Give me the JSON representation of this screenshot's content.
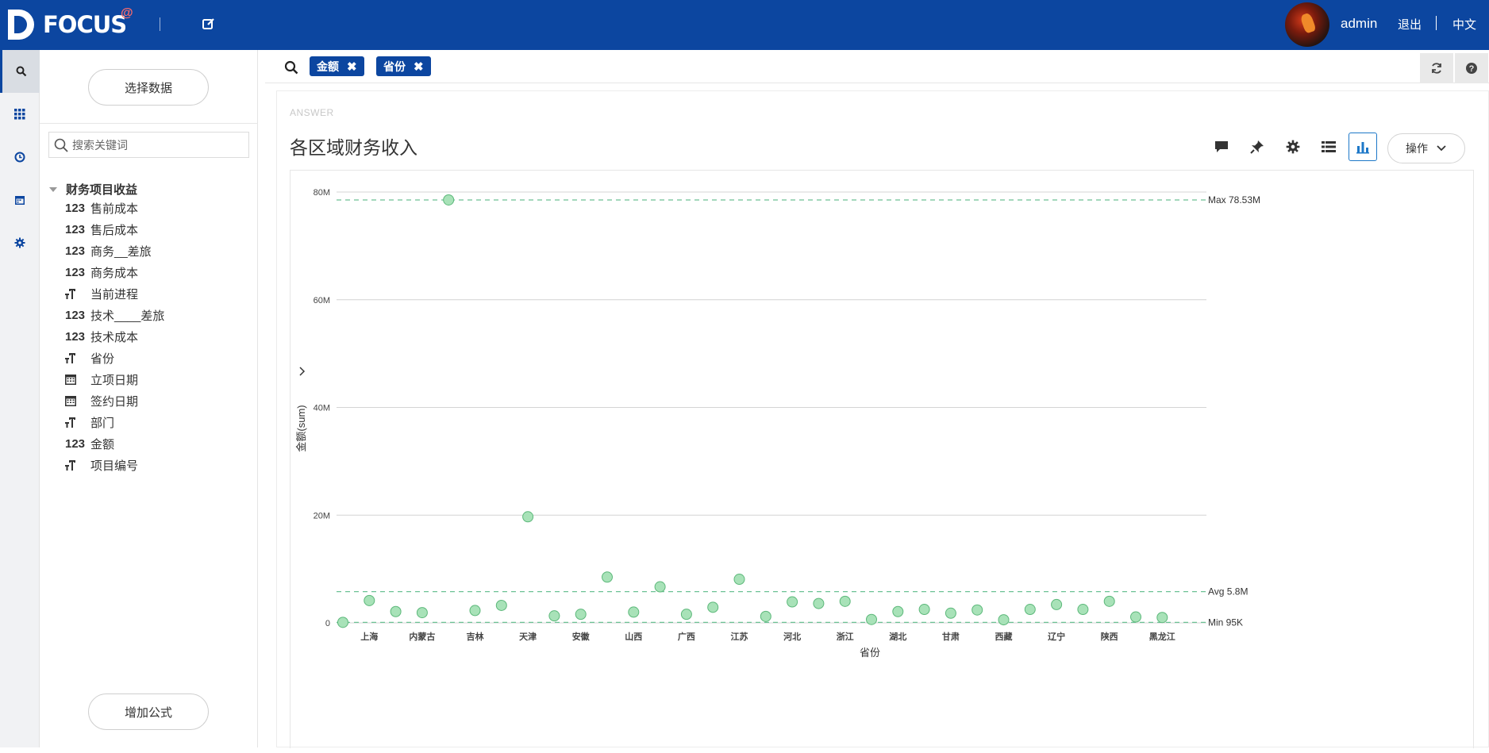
{
  "app": {
    "logo_text": "FOCUS",
    "logo_superscript": "@",
    "user": "admin",
    "logout": "退出",
    "language": "中文",
    "colors": {
      "topbar": "#0c46a0",
      "chip": "#0c46a0",
      "point_fill": "#a8e2b8",
      "point_stroke": "#5cb87a",
      "ref_line": "#6cc194"
    }
  },
  "rail": {
    "items": [
      "search-icon",
      "grid-icon",
      "clock-icon",
      "calendar-icon",
      "gear-icon"
    ]
  },
  "sidebar": {
    "select_data_button": "选择数据",
    "search_placeholder": "搜索关键词",
    "root_label": "财务项目收益",
    "fields": [
      {
        "type": "123",
        "label": "售前成本"
      },
      {
        "type": "123",
        "label": "售后成本"
      },
      {
        "type": "123",
        "label": "商务__差旅"
      },
      {
        "type": "123",
        "label": "商务成本"
      },
      {
        "type": "text",
        "label": "当前进程"
      },
      {
        "type": "123",
        "label": "技术____差旅"
      },
      {
        "type": "123",
        "label": "技术成本"
      },
      {
        "type": "text",
        "label": "省份"
      },
      {
        "type": "date",
        "label": "立项日期"
      },
      {
        "type": "date",
        "label": "签约日期"
      },
      {
        "type": "text",
        "label": "部门"
      },
      {
        "type": "123",
        "label": "金额"
      },
      {
        "type": "text",
        "label": "项目编号"
      }
    ],
    "add_formula_button": "增加公式"
  },
  "query": {
    "chips": [
      {
        "label": "金额"
      },
      {
        "label": "省份"
      }
    ]
  },
  "answer": {
    "tag": "ANSWER",
    "title": "各区域财务收入",
    "ops_label": "操作"
  },
  "chart_data": {
    "type": "scatter",
    "title": "各区域财务收入",
    "ylabel": "金额(sum)",
    "xlabel": "省份",
    "ylim": [
      0,
      80000000
    ],
    "yticks": [
      {
        "value": 0,
        "label": "0"
      },
      {
        "value": 20000000,
        "label": "20M"
      },
      {
        "value": 40000000,
        "label": "40M"
      },
      {
        "value": 60000000,
        "label": "60M"
      },
      {
        "value": 80000000,
        "label": "80M"
      }
    ],
    "x_tick_labels": [
      "上海",
      "内蒙古",
      "吉林",
      "天津",
      "安徽",
      "山西",
      "广西",
      "江苏",
      "河北",
      "浙江",
      "湖北",
      "甘肃",
      "西藏",
      "辽宁",
      "陕西",
      "黑龙江"
    ],
    "x_tick_positions": [
      1,
      3,
      5,
      7,
      9,
      11,
      13,
      15,
      17,
      19,
      21,
      23,
      25,
      27,
      29,
      31
    ],
    "n_points": 32,
    "values": [
      95000,
      4150000,
      2100000,
      1900000,
      78530000,
      2300000,
      3250000,
      19700000,
      1300000,
      1600000,
      8500000,
      2000000,
      6700000,
      1600000,
      2900000,
      8100000,
      1200000,
      3900000,
      3600000,
      4000000,
      630000,
      2100000,
      2500000,
      1800000,
      2400000,
      580000,
      2500000,
      3400000,
      2500000,
      4000000,
      1100000,
      1000000
    ],
    "reference_lines": [
      {
        "kind": "max",
        "value": 78530000,
        "label": "Max 78.53M"
      },
      {
        "kind": "avg",
        "value": 5800000,
        "label": "Avg 5.8M"
      },
      {
        "kind": "min",
        "value": 95000,
        "label": "Min 95K"
      }
    ],
    "grid": true
  }
}
